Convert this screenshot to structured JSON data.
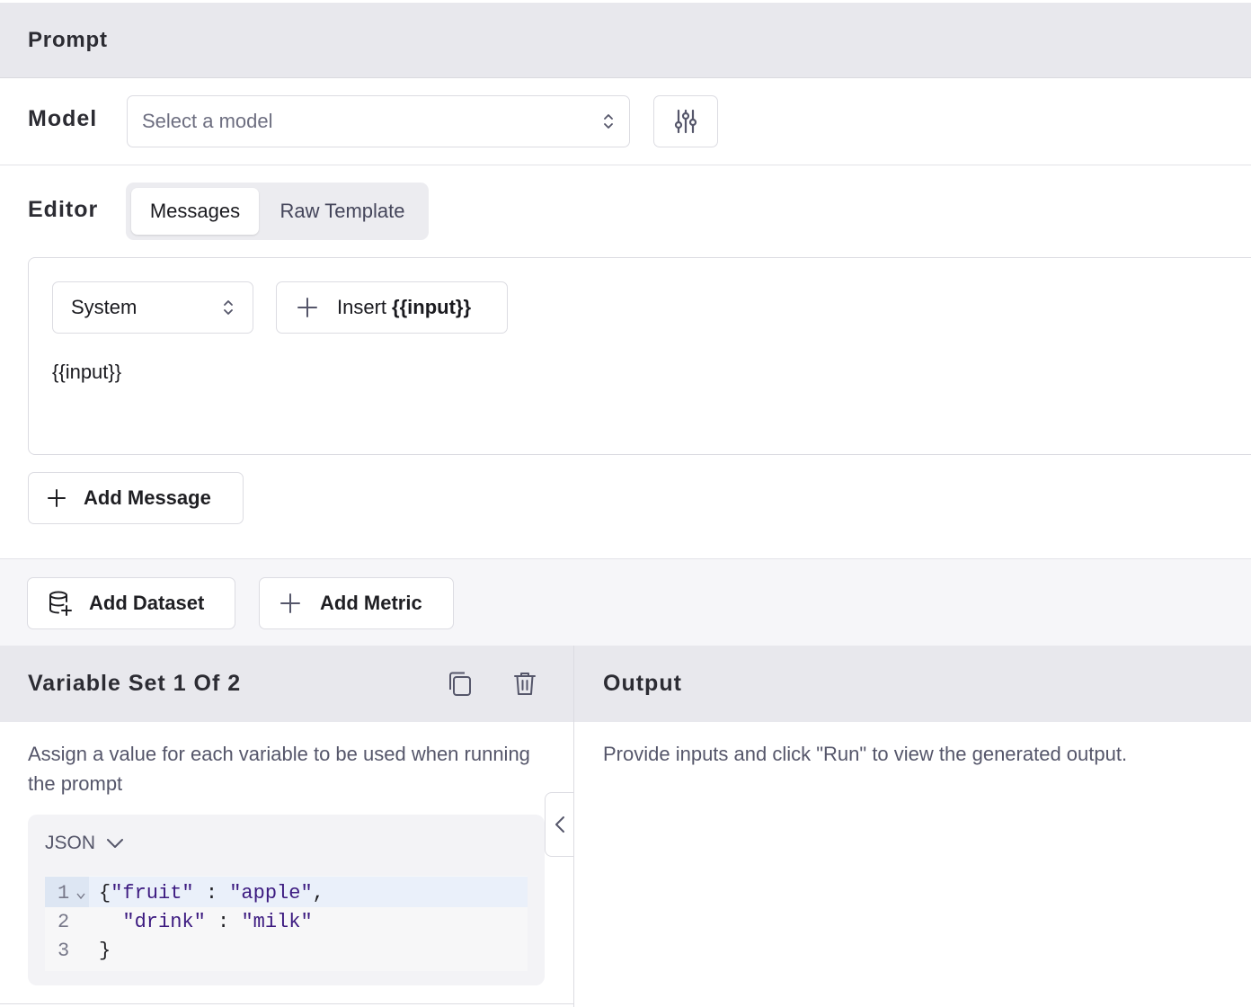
{
  "prompt_header": {
    "title": "Prompt"
  },
  "model": {
    "label": "Model",
    "select_placeholder": "Select a model",
    "settings_icon": "sliders-icon"
  },
  "editor": {
    "label": "Editor",
    "tabs": [
      {
        "label": "Messages",
        "active": true
      },
      {
        "label": "Raw Template",
        "active": false
      }
    ]
  },
  "message": {
    "role": "System",
    "insert_prefix": "Insert",
    "insert_variable": "{{input}}",
    "content": "{{input}}"
  },
  "add_message": {
    "label": "Add Message"
  },
  "toolbar": {
    "add_dataset": "Add Dataset",
    "add_metric": "Add Metric"
  },
  "variables": {
    "title": "Variable Set 1 Of 2",
    "description": "Assign a value for each variable to be used when running the prompt",
    "format": "JSON",
    "code_lines": [
      {
        "num": "1",
        "text": "{\"fruit\" : \"apple\","
      },
      {
        "num": "2",
        "text": "  \"drink\" : \"milk\""
      },
      {
        "num": "3",
        "text": "}"
      }
    ]
  },
  "output": {
    "title": "Output",
    "placeholder": "Provide inputs and click \"Run\" to view the generated output."
  },
  "colors": {
    "header_bg": "#e8e8ed",
    "toolbar_bg": "#f6f6f9",
    "border": "#dcdce2",
    "muted_text": "#55566a",
    "code_string": "#3c1a80",
    "active_line": "#eaf0fa"
  }
}
